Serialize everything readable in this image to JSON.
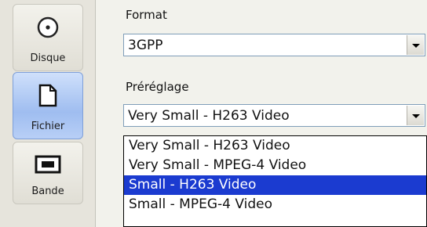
{
  "sidebar": {
    "items": [
      {
        "label": "Disque",
        "icon": "disc-icon",
        "selected": false
      },
      {
        "label": "Fichier",
        "icon": "file-icon",
        "selected": true
      },
      {
        "label": "Bande",
        "icon": "tape-icon",
        "selected": false
      }
    ]
  },
  "format": {
    "label": "Format",
    "value": "3GPP"
  },
  "preset": {
    "label": "Préréglage",
    "value": "Very Small - H263 Video",
    "options": [
      {
        "label": "Very Small - H263 Video",
        "highlighted": false
      },
      {
        "label": "Very Small - MPEG-4 Video",
        "highlighted": false
      },
      {
        "label": "Small - H263 Video",
        "highlighted": true
      },
      {
        "label": "Small - MPEG-4 Video",
        "highlighted": false
      }
    ]
  },
  "colors": {
    "highlight": "#1b3bd0",
    "selected_item": "#9fbdf0"
  }
}
